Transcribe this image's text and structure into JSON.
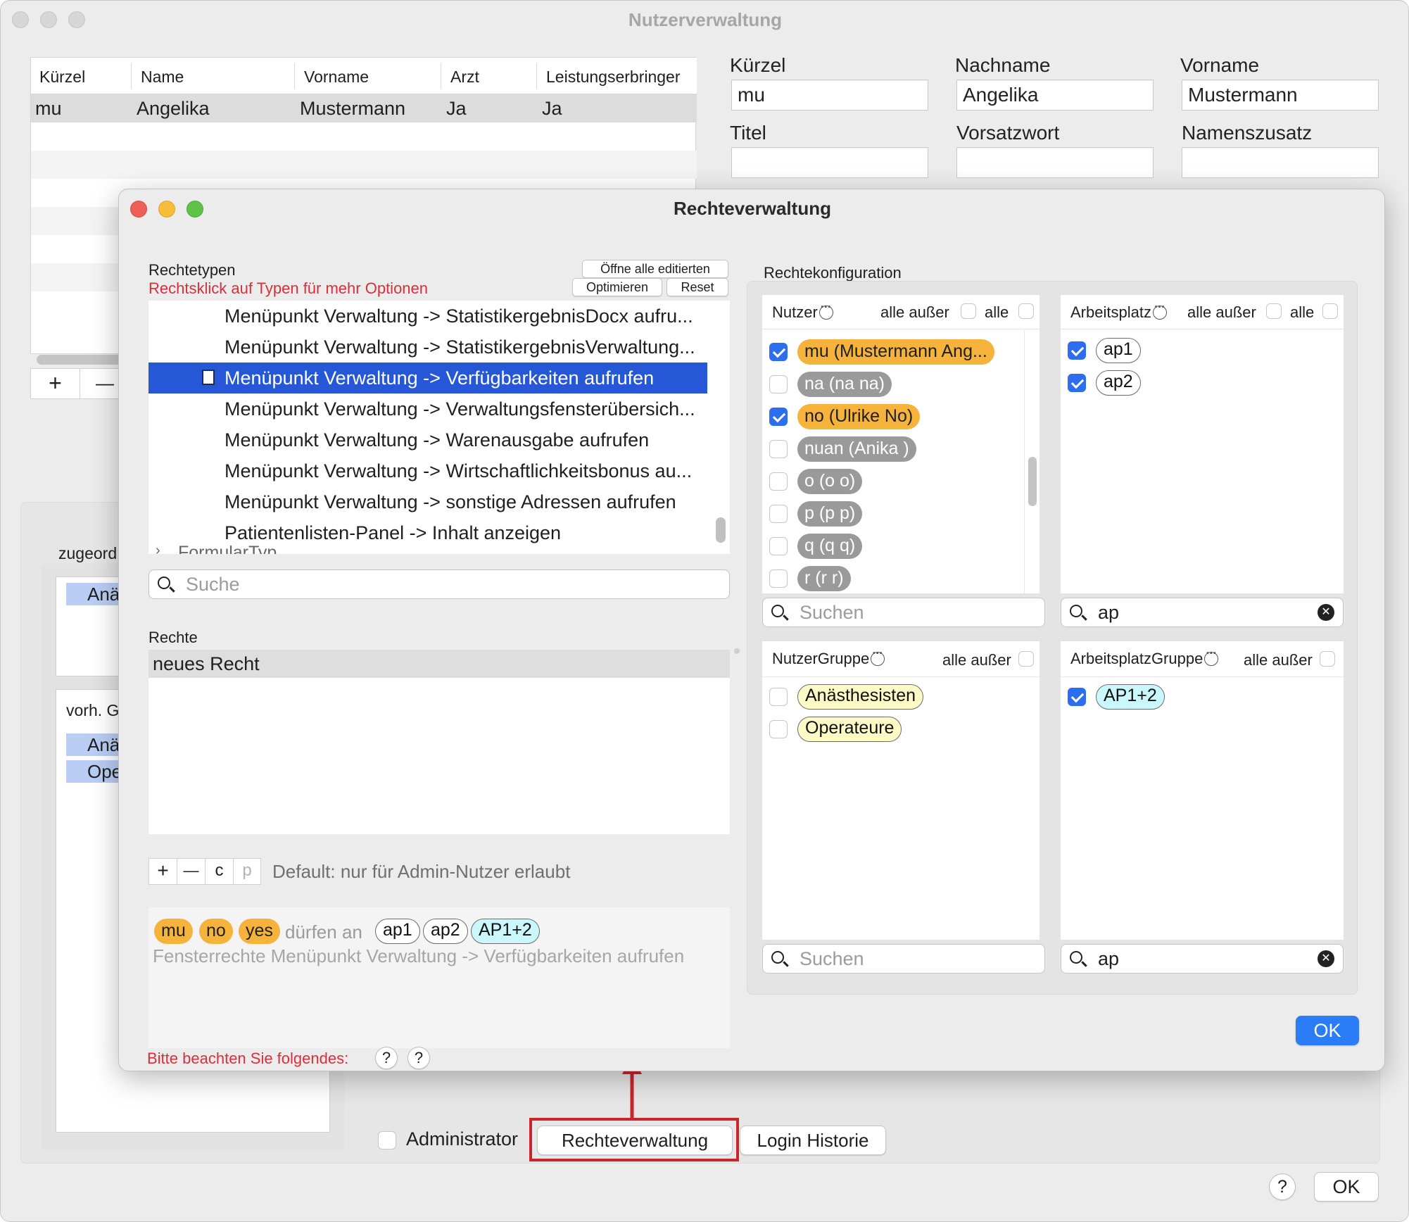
{
  "main_window": {
    "title": "Nutzerverwaltung",
    "table": {
      "headers": [
        "Kürzel",
        "Name",
        "Vorname",
        "Arzt",
        "Leistungserbringer"
      ],
      "rows": [
        [
          "mu",
          "Angelika",
          "Mustermann",
          "Ja",
          "Ja"
        ]
      ]
    },
    "fields": {
      "kuerzel_label": "Kürzel",
      "kuerzel_value": "mu",
      "nachname_label": "Nachname",
      "nachname_value": "Angelika",
      "vorname_label": "Vorname",
      "vorname_value": "Mustermann",
      "titel_label": "Titel",
      "titel_value": "",
      "vorsatzwort_label": "Vorsatzwort",
      "vorsatzwort_value": "",
      "namenszusatz_label": "Namenszusatz",
      "namenszusatz_value": ""
    },
    "add_label": "+",
    "remove_label": "—",
    "zugeordnet_label": "zugeord",
    "zugeordnet_items": [
      "Anä"
    ],
    "vorh_label": "vorh. G",
    "vorh_items": [
      "Anä",
      "Ope"
    ],
    "administrator_label": "Administrator",
    "administrator_checked": false,
    "rechteverwaltung_button": "Rechteverwaltung",
    "login_historie_button": "Login Historie",
    "help_label": "?",
    "ok_label": "OK"
  },
  "dialog": {
    "title": "Rechteverwaltung",
    "rechtetypen_label": "Rechtetypen",
    "rechtetypen_hint": "Rechtsklick auf Typen für mehr Optionen",
    "oeffne_button": "Öffne alle editierten",
    "optimieren_button": "Optimieren",
    "reset_button": "Reset",
    "rechtetypen_list": [
      {
        "label": "Menüpunkt Verwaltung -> StatistikergebnisDocx aufru...",
        "selected": false
      },
      {
        "label": "Menüpunkt Verwaltung -> StatistikergebnisVerwaltung...",
        "selected": false
      },
      {
        "label": "Menüpunkt Verwaltung -> Verfügbarkeiten aufrufen",
        "selected": true
      },
      {
        "label": "Menüpunkt Verwaltung -> Verwaltungsfensterübersich...",
        "selected": false
      },
      {
        "label": "Menüpunkt Verwaltung -> Warenausgabe aufrufen",
        "selected": false
      },
      {
        "label": "Menüpunkt Verwaltung -> Wirtschaftlichkeitsbonus au...",
        "selected": false
      },
      {
        "label": "Menüpunkt Verwaltung -> sonstige Adressen aufrufen",
        "selected": false
      },
      {
        "label": "Patientenlisten-Panel -> Inhalt anzeigen",
        "selected": false
      }
    ],
    "formulartyp_partial": "FormularTyp",
    "search_placeholder": "Suche",
    "rechte_label": "Rechte",
    "rechte_items": [
      "neues Recht"
    ],
    "rechte_toolbar": {
      "add": "+",
      "remove": "—",
      "c": "c",
      "p": "p"
    },
    "default_text": "Default: nur für Admin-Nutzer erlaubt",
    "summary": {
      "users": [
        "mu",
        "no",
        "yes"
      ],
      "verb": "dürfen an",
      "targets": [
        "ap1",
        "ap2",
        "AP1+2"
      ],
      "description": "Fensterrechte Menüpunkt Verwaltung -> Verfügbarkeiten aufrufen"
    },
    "bitte_text": "Bitte beachten Sie folgendes:",
    "help_label": "?",
    "rechtekonfiguration_label": "Rechtekonfiguration",
    "nutzer": {
      "title": "Nutzer",
      "alle_ausser_label": "alle außer",
      "alle_label": "alle",
      "items": [
        {
          "label": "mu (Mustermann Ang...",
          "checked": true,
          "style": "orange"
        },
        {
          "label": "na (na na)",
          "checked": false,
          "style": "gray"
        },
        {
          "label": "no (Ulrike No)",
          "checked": true,
          "style": "orange"
        },
        {
          "label": "nuan (Anika )",
          "checked": false,
          "style": "gray"
        },
        {
          "label": "o (o o)",
          "checked": false,
          "style": "gray"
        },
        {
          "label": "p (p p)",
          "checked": false,
          "style": "gray"
        },
        {
          "label": "q (q q)",
          "checked": false,
          "style": "gray"
        },
        {
          "label": "r (r r)",
          "checked": false,
          "style": "gray"
        }
      ],
      "search_placeholder": "Suchen"
    },
    "arbeitsplatz": {
      "title": "Arbeitsplatz",
      "alle_ausser_label": "alle außer",
      "alle_label": "alle",
      "items": [
        {
          "label": "ap1",
          "checked": true
        },
        {
          "label": "ap2",
          "checked": true
        }
      ],
      "search_value": "ap"
    },
    "nutzergruppe": {
      "title": "NutzerGruppe",
      "alle_ausser_label": "alle außer",
      "items": [
        {
          "label": "Anästhesisten",
          "checked": false
        },
        {
          "label": "Operateure",
          "checked": false
        }
      ],
      "search_placeholder": "Suchen"
    },
    "arbeitsplatzgruppe": {
      "title": "ArbeitsplatzGruppe",
      "alle_ausser_label": "alle außer",
      "items": [
        {
          "label": "AP1+2",
          "checked": true
        }
      ],
      "search_value": "ap"
    },
    "ok_label": "OK"
  },
  "annotation": {
    "highlight_color": "#c8252c"
  }
}
